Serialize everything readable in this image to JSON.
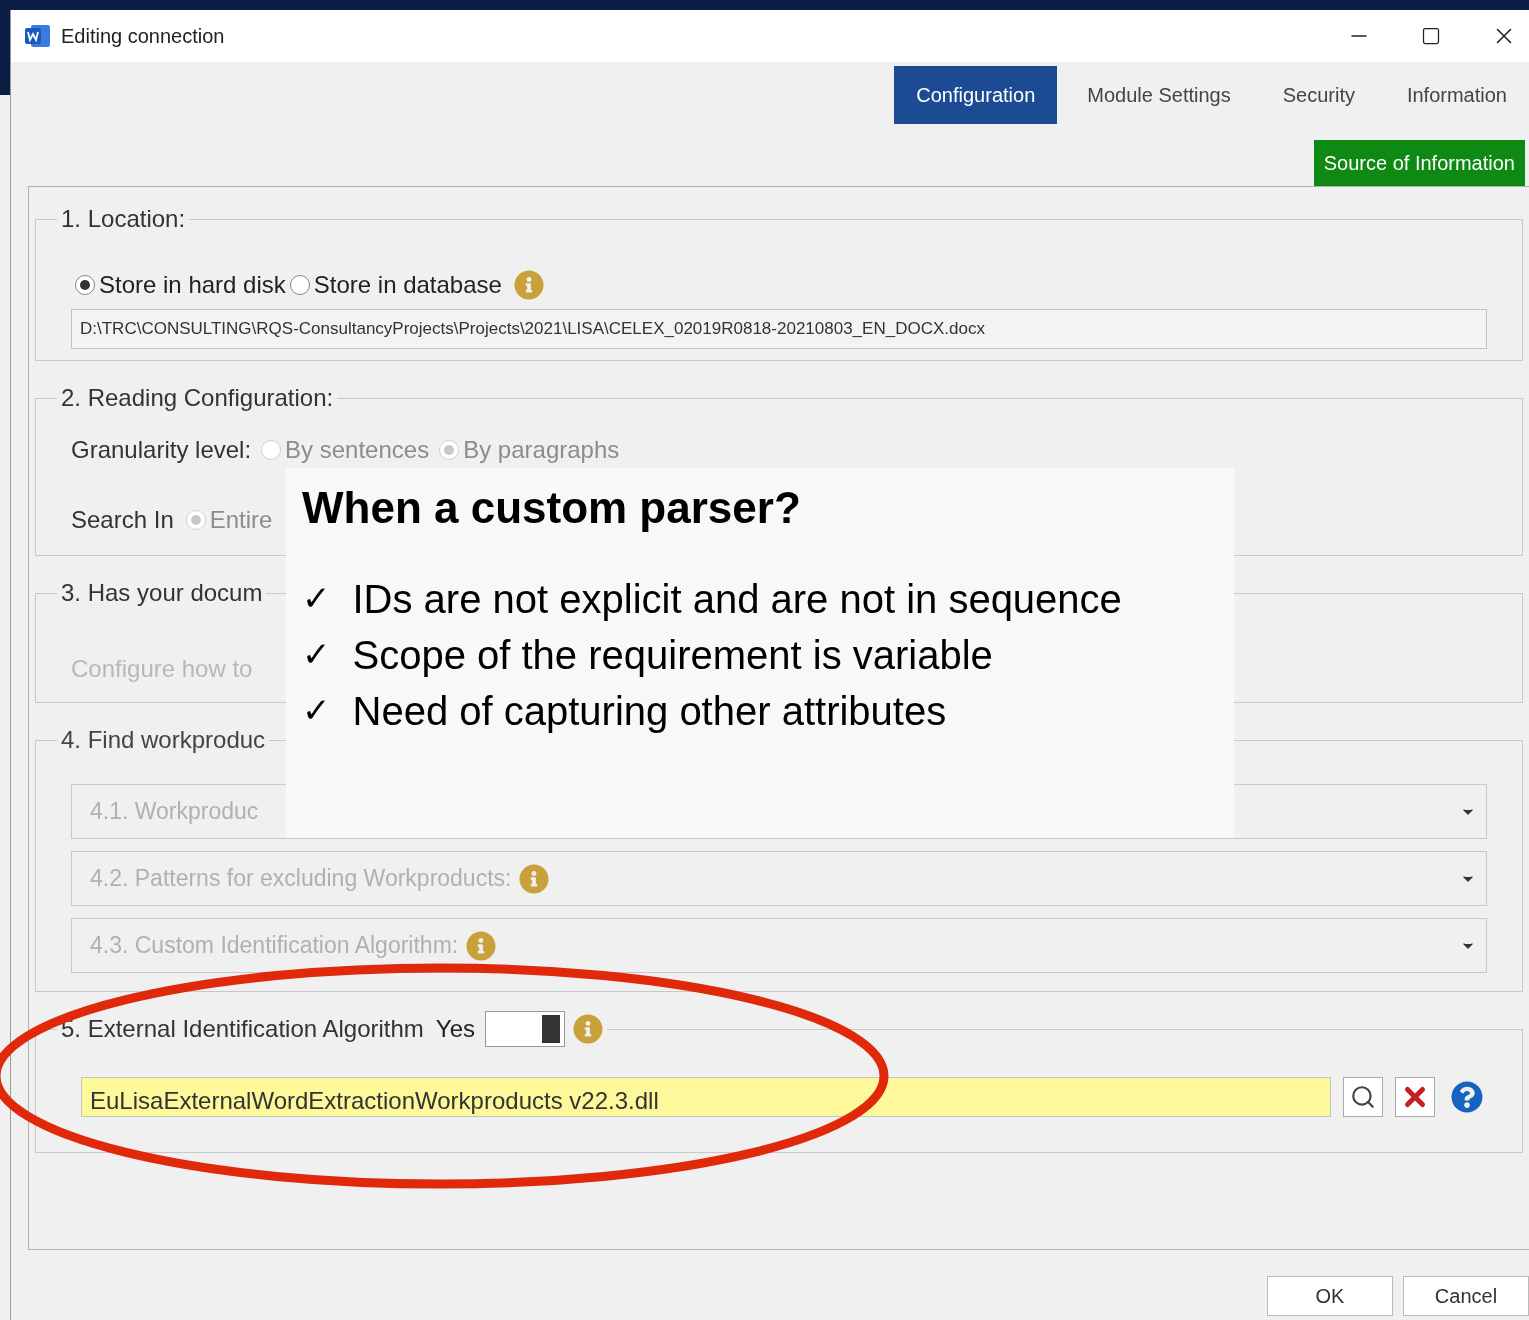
{
  "window": {
    "title": "Editing connection"
  },
  "tabs": [
    {
      "label": "Configuration",
      "selected": true
    },
    {
      "label": "Module Settings",
      "selected": false
    },
    {
      "label": "Security",
      "selected": false
    },
    {
      "label": "Information",
      "selected": false
    }
  ],
  "source_button": "Source of Information",
  "location": {
    "legend": "1. Location:",
    "options": [
      {
        "label": "Store in hard disk",
        "selected": true
      },
      {
        "label": "Store in database",
        "selected": false
      }
    ],
    "path": "D:\\TRC\\CONSULTING\\RQS-ConsultancyProjects\\Projects\\2021\\LISA\\CELEX_02019R0818-20210803_EN_DOCX.docx"
  },
  "reading": {
    "legend": "2. Reading Configuration:",
    "granularity_label": "Granularity level:",
    "granularity_options": [
      {
        "label": "By sentences",
        "selected": false
      },
      {
        "label": "By paragraphs",
        "selected": true
      }
    ],
    "search_label": "Search In",
    "search_options": [
      {
        "label": "Entire",
        "selected": true
      }
    ]
  },
  "identifiers": {
    "legend": "3. Has your docum",
    "configure_label": "Configure how to"
  },
  "find": {
    "legend": "4. Find workproduc",
    "dropdowns": [
      {
        "label": "4.1. Workproduc",
        "disabled": true,
        "info": false
      },
      {
        "label": "4.2. Patterns for excluding Workproducts:",
        "disabled": true,
        "info": true
      },
      {
        "label": "4.3. Custom Identification Algorithm:",
        "disabled": true,
        "info": true
      }
    ]
  },
  "external": {
    "legend": "5. External Identification Algorithm",
    "state_label": "Yes",
    "on": true,
    "file": "EuLisaExternalWordExtractionWorkproducts v22.3.dll"
  },
  "buttons": [
    "OK",
    "Cancel"
  ],
  "callout": {
    "title": "When a custom parser?",
    "items": [
      {
        "mark": "✓",
        "text": "IDs are not explicit and are not in sequence"
      },
      {
        "mark": "✓",
        "text": "Scope of the requirement is variable"
      },
      {
        "mark": "✓",
        "text": "Need of capturing other attributes"
      }
    ]
  }
}
